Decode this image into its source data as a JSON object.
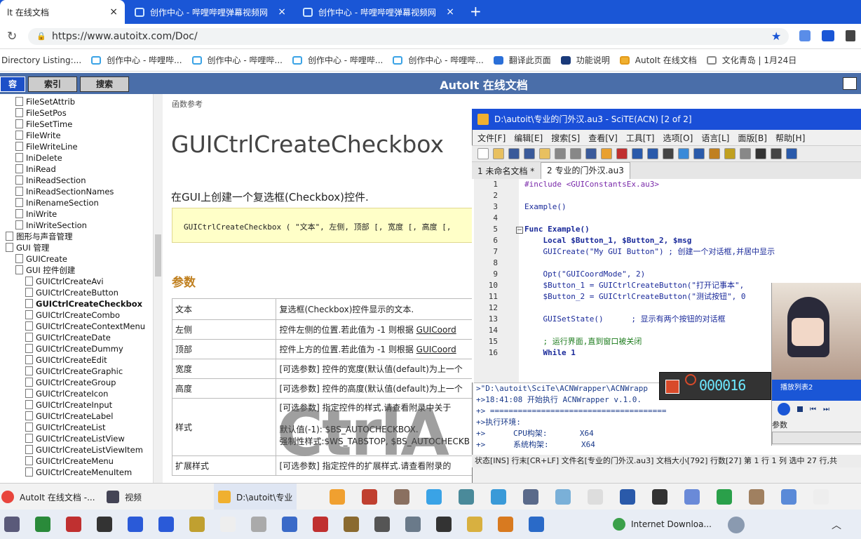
{
  "browser": {
    "tabs": [
      {
        "title": "lt 在线文档",
        "close": "×"
      },
      {
        "title": "创作中心 - 哔哩哔哩弹幕视频网",
        "close": "×"
      },
      {
        "title": "创作中心 - 哔哩哔哩弹幕视频网",
        "close": "×"
      }
    ],
    "new_tab": "+",
    "url": "https://www.autoitx.com/Doc/",
    "bookmarks": [
      "Directory Listing:...",
      "创作中心 - 哔哩哔...",
      "创作中心 - 哔哩哔...",
      "创作中心 - 哔哩哔...",
      "创作中心 - 哔哩哔...",
      "翻译此页面",
      "功能说明",
      "AutoIt 在线文档",
      "文化青岛 | 1月24日"
    ]
  },
  "help": {
    "title": "AutoIt 在线文档",
    "nav_tabs": [
      "容",
      "索引",
      "搜索"
    ],
    "tree": [
      {
        "label": "FileSetAttrib",
        "indent": 1
      },
      {
        "label": "FileSetPos",
        "indent": 1
      },
      {
        "label": "FileSetTime",
        "indent": 1
      },
      {
        "label": "FileWrite",
        "indent": 1
      },
      {
        "label": "FileWriteLine",
        "indent": 1
      },
      {
        "label": "IniDelete",
        "indent": 1
      },
      {
        "label": "IniRead",
        "indent": 1
      },
      {
        "label": "IniReadSection",
        "indent": 1
      },
      {
        "label": "IniReadSectionNames",
        "indent": 1
      },
      {
        "label": "IniRenameSection",
        "indent": 1
      },
      {
        "label": "IniWrite",
        "indent": 1
      },
      {
        "label": "IniWriteSection",
        "indent": 1
      },
      {
        "label": "图形与声音管理",
        "indent": 0
      },
      {
        "label": "GUI 管理",
        "indent": 0
      },
      {
        "label": "GUICreate",
        "indent": 1
      },
      {
        "label": "GUI 控件创建",
        "indent": 1
      },
      {
        "label": "GUICtrlCreateAvi",
        "indent": 2
      },
      {
        "label": "GUICtrlCreateButton",
        "indent": 2
      },
      {
        "label": "GUICtrlCreateCheckbox",
        "indent": 2,
        "bold": true
      },
      {
        "label": "GUICtrlCreateCombo",
        "indent": 2
      },
      {
        "label": "GUICtrlCreateContextMenu",
        "indent": 2
      },
      {
        "label": "GUICtrlCreateDate",
        "indent": 2
      },
      {
        "label": "GUICtrlCreateDummy",
        "indent": 2
      },
      {
        "label": "GUICtrlCreateEdit",
        "indent": 2
      },
      {
        "label": "GUICtrlCreateGraphic",
        "indent": 2
      },
      {
        "label": "GUICtrlCreateGroup",
        "indent": 2
      },
      {
        "label": "GUICtrlCreateIcon",
        "indent": 2
      },
      {
        "label": "GUICtrlCreateInput",
        "indent": 2
      },
      {
        "label": "GUICtrlCreateLabel",
        "indent": 2
      },
      {
        "label": "GUICtrlCreateList",
        "indent": 2
      },
      {
        "label": "GUICtrlCreateListView",
        "indent": 2
      },
      {
        "label": "GUICtrlCreateListViewItem",
        "indent": 2
      },
      {
        "label": "GUICtrlCreateMenu",
        "indent": 2
      },
      {
        "label": "GUICtrlCreateMenuItem",
        "indent": 2
      }
    ],
    "breadcrumb": "函数参考",
    "func_name": "GUICtrlCreateCheckbox",
    "func_desc": "在GUI上创建一个复选框(Checkbox)控件.",
    "syntax": "GUICtrlCreateCheckbox ( \"文本\", 左侧, 顶部 [, 宽度 [, 高度 [,",
    "params_heading": "参数",
    "params": [
      {
        "name": "文本",
        "desc": "复选框(Checkbox)控件显示的文本."
      },
      {
        "name": "左侧",
        "desc": "控件左侧的位置.若此值为 -1 则根据 ",
        "link": "GUICoord"
      },
      {
        "name": "顶部",
        "desc": "控件上方的位置.若此值为 -1 则根据 ",
        "link": "GUICoord"
      },
      {
        "name": "宽度",
        "desc": "[可选参数] 控件的宽度(默认值(default)为上一个"
      },
      {
        "name": "高度",
        "desc": "[可选参数] 控件的高度(默认值(default)为上一个"
      },
      {
        "name": "样式",
        "desc": "[可选参数] 指定控件的样式.请查看附录中关于",
        "extra1": "默认值(-1): $BS_AUTOCHECKBOX.",
        "extra2": "强制性样式:$WS_TABSTOP, $BS_AUTOCHECKB"
      },
      {
        "name": "扩展样式",
        "desc": "[可选参数] 指定控件的扩展样式.请查看附录的"
      }
    ]
  },
  "scite": {
    "title": "D:\\autoit\\专业的门外汉.au3 - SciTE(ACN) [2 of 2]",
    "menu": [
      "文件[F]",
      "编辑[E]",
      "搜索[S]",
      "查看[V]",
      "工具[T]",
      "选项[O]",
      "语言[L]",
      "面版[B]",
      "帮助[H]"
    ],
    "tabs": [
      "1 未命名文档 *",
      "2 专业的门外汉.au3"
    ],
    "lines": [
      {
        "n": "1",
        "t": "#include <GUIConstantsEx.au3>"
      },
      {
        "n": "2",
        "t": ""
      },
      {
        "n": "3",
        "t": "Example()"
      },
      {
        "n": "4",
        "t": ""
      },
      {
        "n": "5",
        "t": "Func Example()"
      },
      {
        "n": "6",
        "t": "    Local $Button_1, $Button_2, $msg"
      },
      {
        "n": "7",
        "t": "    GUICreate(\"My GUI Button\") ; 创建一个对话框,并居中显示"
      },
      {
        "n": "8",
        "t": ""
      },
      {
        "n": "9",
        "t": "    Opt(\"GUICoordMode\", 2)"
      },
      {
        "n": "10",
        "t": "    $Button_1 = GUICtrlCreateButton(\"打开记事本\","
      },
      {
        "n": "11",
        "t": "    $Button_2 = GUICtrlCreateButton(\"测试按钮\", 0"
      },
      {
        "n": "12",
        "t": ""
      },
      {
        "n": "13",
        "t": "    GUISetState()      ; 显示有两个按钮的对话框"
      },
      {
        "n": "14",
        "t": ""
      },
      {
        "n": "15",
        "t": "    ; 运行界面,直到窗口被关闭"
      },
      {
        "n": "16",
        "t": "    While 1"
      }
    ],
    "output": [
      ">\"D:\\autoit\\SciTe\\ACNWrapper\\ACNWrapp",
      "+>18:41:08 开始执行 ACNWrapper v.1.0.",
      "+> ======================================",
      "+>执行环境:",
      "+>      CPU构架:       X64",
      "+>      系统构架:       X64"
    ],
    "status": "状态[INS] 行末[CR+LF] 文件名[专业的门外汉.au3] 文档大小[792] 行数[27] 第 1 行 1 列 选中 27 行,共"
  },
  "recorder": {
    "time": "000016"
  },
  "player": {
    "playlist": "播放列表2",
    "params": "参数"
  },
  "taskbar": {
    "items": [
      "AutoIt 在线文档 -...",
      "视频",
      "D:\\autoit\\专业"
    ],
    "bottom_item": "Internet Downloa..."
  },
  "watermark": "CtrlA"
}
